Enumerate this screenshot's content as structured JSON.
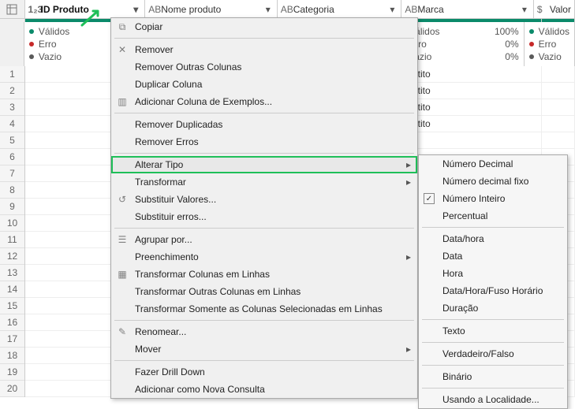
{
  "columns": [
    {
      "name": "ID Produto",
      "type": "number"
    },
    {
      "name": "Nome produto",
      "type": "text"
    },
    {
      "name": "Categoria",
      "type": "text"
    },
    {
      "name": "Marca",
      "type": "text"
    },
    {
      "name": "Valor",
      "type": "currency"
    }
  ],
  "quality_labels": {
    "valid": "Válidos",
    "error": "Erro",
    "empty": "Vazio"
  },
  "marca_stats": {
    "valid_pct": "100%",
    "error_pct": "0%",
    "empty_pct": "0%"
  },
  "row_numbers": [
    1,
    2,
    3,
    4,
    5,
    6,
    7,
    8,
    9,
    10,
    11,
    12,
    13,
    14,
    15,
    16,
    17,
    18,
    19,
    20
  ],
  "marca_values": [
    "atito",
    "atito",
    "atito",
    "atito"
  ],
  "context_menu": {
    "copiar": "Copiar",
    "remover": "Remover",
    "remover_outras": "Remover Outras Colunas",
    "duplicar": "Duplicar Coluna",
    "add_exemplos": "Adicionar Coluna de Exemplos...",
    "remover_dup": "Remover Duplicadas",
    "remover_erros": "Remover Erros",
    "alterar_tipo": "Alterar Tipo",
    "transformar": "Transformar",
    "subst_valores": "Substituir Valores...",
    "subst_erros": "Substituir erros...",
    "agrupar": "Agrupar por...",
    "preench": "Preenchimento",
    "transf_col_linhas": "Transformar Colunas em Linhas",
    "transf_outras_linhas": "Transformar Outras Colunas em Linhas",
    "transf_sel_linhas": "Transformar Somente as Colunas Selecionadas em Linhas",
    "renomear": "Renomear...",
    "mover": "Mover",
    "drill": "Fazer Drill Down",
    "nova_consulta": "Adicionar como Nova Consulta"
  },
  "type_menu": {
    "decimal": "Número Decimal",
    "decimal_fixo": "Número decimal fixo",
    "inteiro": "Número Inteiro",
    "percentual": "Percentual",
    "datahora": "Data/hora",
    "data": "Data",
    "hora": "Hora",
    "dthfuso": "Data/Hora/Fuso Horário",
    "duracao": "Duração",
    "texto": "Texto",
    "vf": "Verdadeiro/Falso",
    "binario": "Binário",
    "localidade": "Usando a Localidade..."
  }
}
